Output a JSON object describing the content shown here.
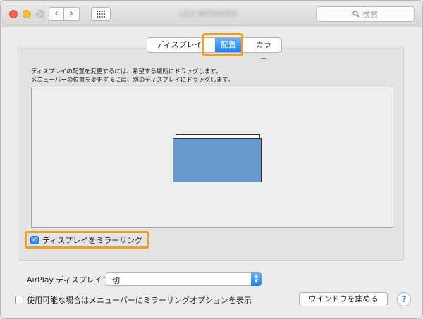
{
  "window": {
    "title": "LG3 WFDHHDE",
    "search_placeholder": "検索"
  },
  "tabs": [
    {
      "label": "ディスプレイ",
      "selected": false
    },
    {
      "label": "配置",
      "selected": true
    },
    {
      "label": "カラー",
      "selected": false
    }
  ],
  "arrangement": {
    "instruction_line1": "ディスプレイの配置を変更するには、希望する場所にドラッグします。",
    "instruction_line2": "メニューバーの位置を変更するには、別のディスプレイにドラッグします。"
  },
  "mirror_checkbox": {
    "label": "ディスプレイをミラーリング",
    "checked": true
  },
  "airplay": {
    "label": "AirPlay ディスプレイ：",
    "selected_value": "切"
  },
  "options_checkbox": {
    "label": "使用可能な場合はメニューバーにミラーリングオプションを表示",
    "checked": false
  },
  "gather_button": {
    "label": "ウインドウを集める"
  },
  "help_button": {
    "label": "?"
  },
  "colors": {
    "highlight": "#f2a01d",
    "accent": "#1a82fb",
    "display_fill": "#6699cc"
  }
}
